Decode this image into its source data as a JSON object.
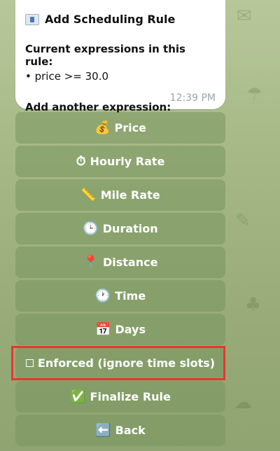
{
  "message": {
    "title": "Add Scheduling Rule",
    "current_label": "Current expressions in this rule:",
    "expression": "• price >= 30.0",
    "prompt": "Add another expression:",
    "time": "12:39 PM"
  },
  "keyboard": {
    "price": "Price",
    "hourly_rate": "Hourly Rate",
    "mile_rate": "Mile Rate",
    "duration": "Duration",
    "distance": "Distance",
    "time": "Time",
    "days": "Days",
    "enforced": "Enforced (ignore time slots)",
    "finalize": "Finalize Rule",
    "back": "Back"
  },
  "icons": {
    "price": "money-bag-icon",
    "hourly_rate": "stopwatch-icon",
    "mile_rate": "ruler-icon",
    "duration": "clock-icon",
    "distance": "pin-icon",
    "time": "clock-icon",
    "days": "calendar-icon",
    "enforced": "checkbox-icon",
    "finalize": "check-mark-icon",
    "back": "left-arrow-icon"
  },
  "colors": {
    "highlight": "#e5372e"
  }
}
